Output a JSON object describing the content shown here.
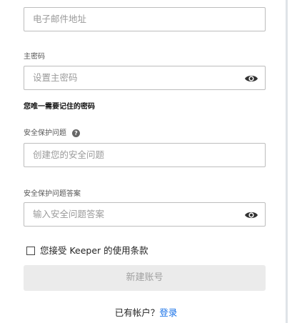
{
  "form": {
    "email": {
      "placeholder": "电子邮件地址"
    },
    "master_password": {
      "label": "主密码",
      "placeholder": "设置主密码",
      "hint": "您唯一需要记住的密码"
    },
    "security_question": {
      "label": "安全保护问题",
      "placeholder": "创建您的安全问题"
    },
    "security_answer": {
      "label": "安全保护问题答案",
      "placeholder": "输入安全问题答案"
    },
    "terms_label": "您接受 Keeper 的使用条款",
    "submit_label": "新建账号",
    "login_prompt": "已有帐户？",
    "login_link": "登录"
  },
  "icons": {
    "visibility": "eye-icon",
    "help": "help-icon"
  },
  "colors": {
    "link": "#1a73e8",
    "button_bg": "#ebebeb"
  }
}
